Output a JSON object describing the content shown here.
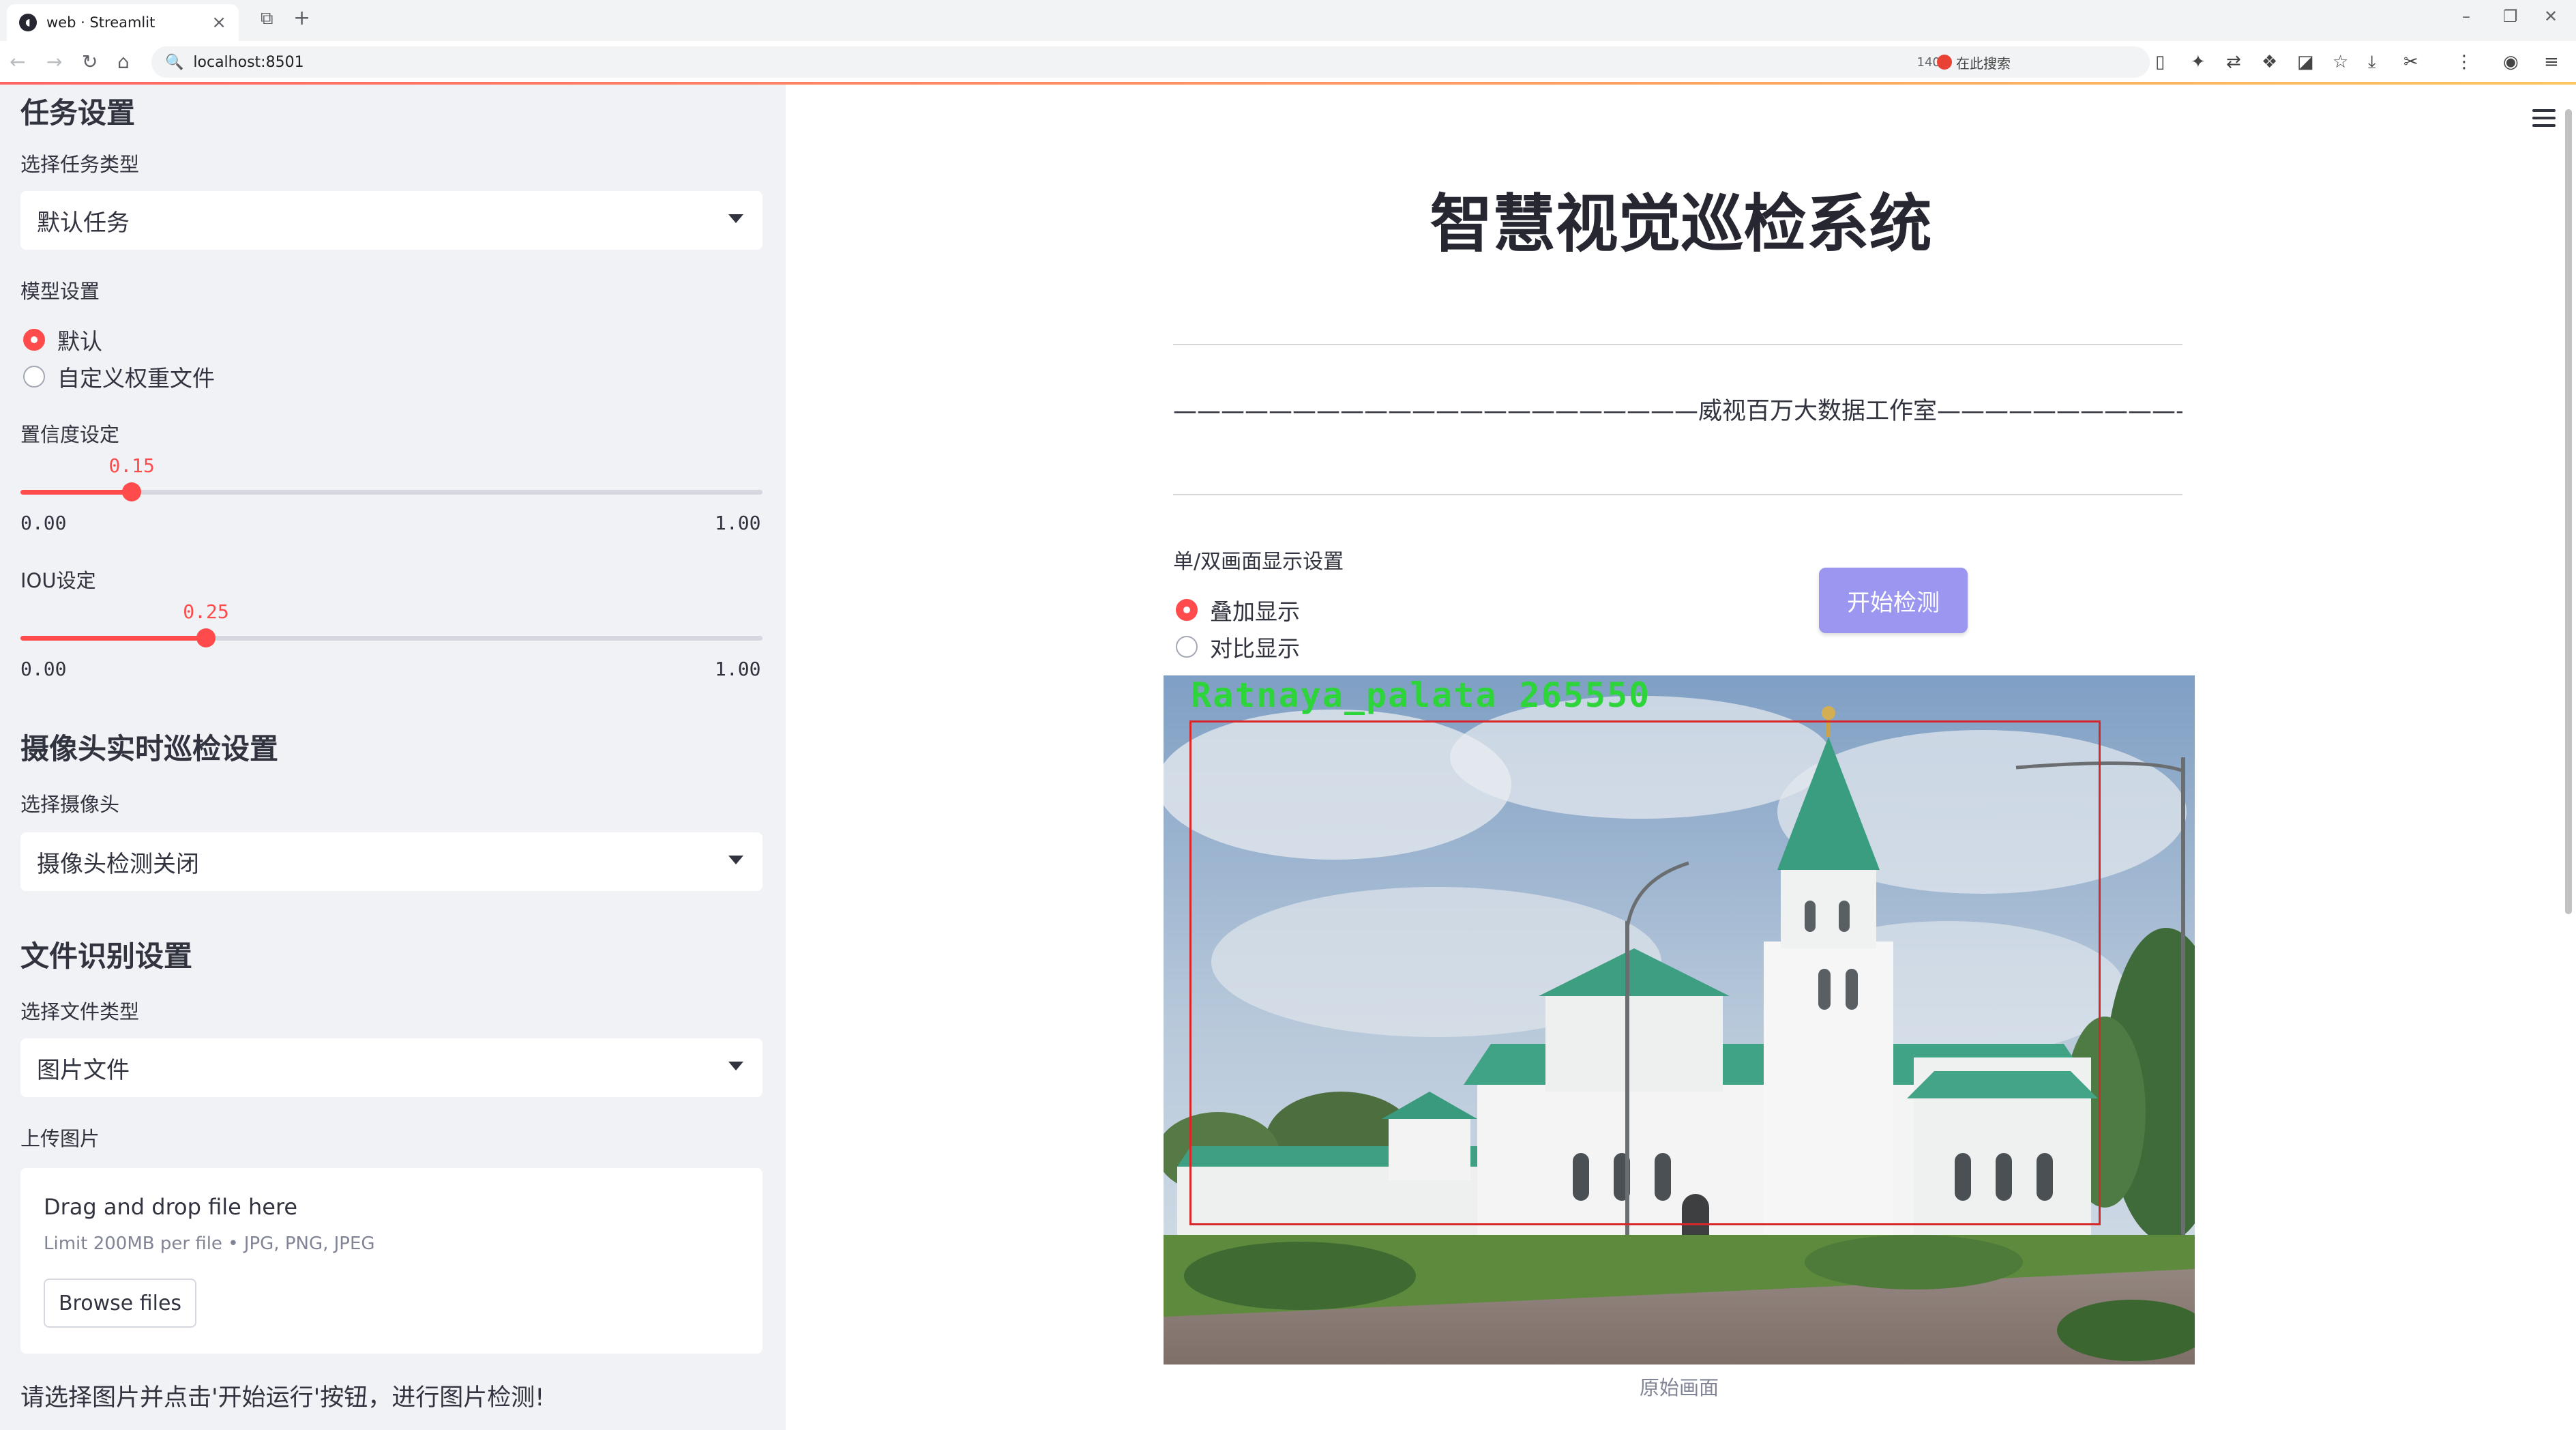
{
  "browser": {
    "tab_title": "web · Streamlit",
    "url": "localhost:8501",
    "zoom": "140%",
    "search_placeholder": "在此搜索"
  },
  "sidebar": {
    "task_section_title": "任务设置",
    "task_type_label": "选择任务类型",
    "task_type_value": "默认任务",
    "model_label": "模型设置",
    "model_options": [
      "默认",
      "自定义权重文件"
    ],
    "model_selected": 0,
    "conf_label": "置信度设定",
    "conf_value": "0.15",
    "conf_fraction": 0.15,
    "iou_label": "IOU设定",
    "iou_value": "0.25",
    "iou_fraction": 0.25,
    "slider_min": "0.00",
    "slider_max": "1.00",
    "camera_section_title": "摄像头实时巡检设置",
    "camera_label": "选择摄像头",
    "camera_value": "摄像头检测关闭",
    "file_section_title": "文件识别设置",
    "file_type_label": "选择文件类型",
    "file_type_value": "图片文件",
    "upload_label": "上传图片",
    "dropzone_title": "Drag and drop file here",
    "dropzone_sub": "Limit 200MB per file • JPG, PNG, JPEG",
    "browse_label": "Browse files",
    "note": "请选择图片并点击'开始运行'按钮，进行图片检测!"
  },
  "main": {
    "title": "智慧视觉巡检系统",
    "subtitle": "——————————————————————威视百万大数据工作室——————————————————————",
    "display_label": "单/双画面显示设置",
    "display_options": [
      "叠加显示",
      "对比显示"
    ],
    "display_selected": 0,
    "start_button": "开始检测",
    "detection_label": "Ratnaya_palata 265550",
    "image_caption": "原始画面"
  },
  "colors": {
    "accent": "#ff4b4b",
    "sidebar_bg": "#f0f2f6",
    "button": "#9b96f0",
    "detection_box": "#d62828",
    "detection_text": "#2dd43a"
  }
}
